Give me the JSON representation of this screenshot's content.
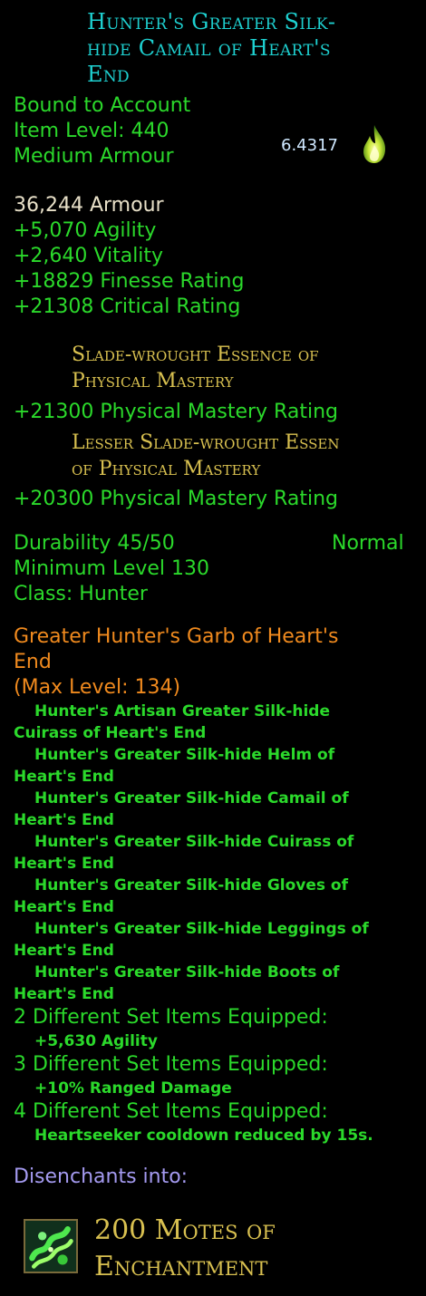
{
  "item": {
    "name_lines": [
      "Hunter's Greater Silk-",
      "hide Camail of Heart's",
      "End"
    ],
    "binding": "Bound to Account",
    "item_level": "Item Level: 440",
    "type": "Medium Armour",
    "value": "6.4317",
    "armour": "36,244 Armour",
    "stats": [
      "+5,070 Agility",
      "+2,640 Vitality",
      "+18829 Finesse Rating",
      "+21308 Critical Rating"
    ],
    "essences": [
      {
        "title_lines": [
          "Slade-wrought Essence of",
          "Physical Mastery"
        ],
        "stat": "+21300 Physical Mastery Rating"
      },
      {
        "title_lines": [
          "Lesser Slade-wrought Essen",
          "of Physical Mastery"
        ],
        "stat": "+20300 Physical Mastery Rating"
      }
    ],
    "durability": "Durability 45/50",
    "quality": "Normal",
    "min_level": "Minimum Level 130",
    "class_label": "Class:",
    "class_value": " Hunter"
  },
  "set": {
    "name_lines": [
      "Greater Hunter's Garb of Heart's",
      "End"
    ],
    "max_level": "(Max Level: 134)",
    "pieces": [
      [
        "Hunter's Artisan Greater Silk-hide",
        "Cuirass of Heart's End"
      ],
      [
        "Hunter's Greater Silk-hide Helm of",
        "Heart's End"
      ],
      [
        "Hunter's Greater Silk-hide Camail of",
        "Heart's End"
      ],
      [
        "Hunter's Greater Silk-hide Cuirass of",
        "Heart's End"
      ],
      [
        "Hunter's Greater Silk-hide Gloves of",
        "Heart's End"
      ],
      [
        "Hunter's Greater Silk-hide Leggings of",
        "Heart's End"
      ],
      [
        "Hunter's Greater Silk-hide Boots of",
        "Heart's End"
      ]
    ],
    "bonuses": [
      {
        "header": "2 Different Set Items Equipped:",
        "effect": "+5,630 Agility"
      },
      {
        "header": "3 Different Set Items Equipped:",
        "effect": "+10% Ranged Damage"
      },
      {
        "header": "4 Different Set Items Equipped:",
        "effect": "Heartseeker cooldown reduced by 15s."
      }
    ]
  },
  "disenchant": {
    "label": "Disenchants into:",
    "result_lines": [
      "200 Motes of",
      "Enchantment"
    ]
  },
  "icons": {
    "value": "flame-icon",
    "result": "motes-of-enchantment-icon"
  },
  "colors": {
    "name": "#1ed0d0",
    "green": "#2bd92b",
    "white": "#e8e0c8",
    "essence": "#d8c050",
    "set": "#f08a1e",
    "disenchant": "#a49af0"
  }
}
